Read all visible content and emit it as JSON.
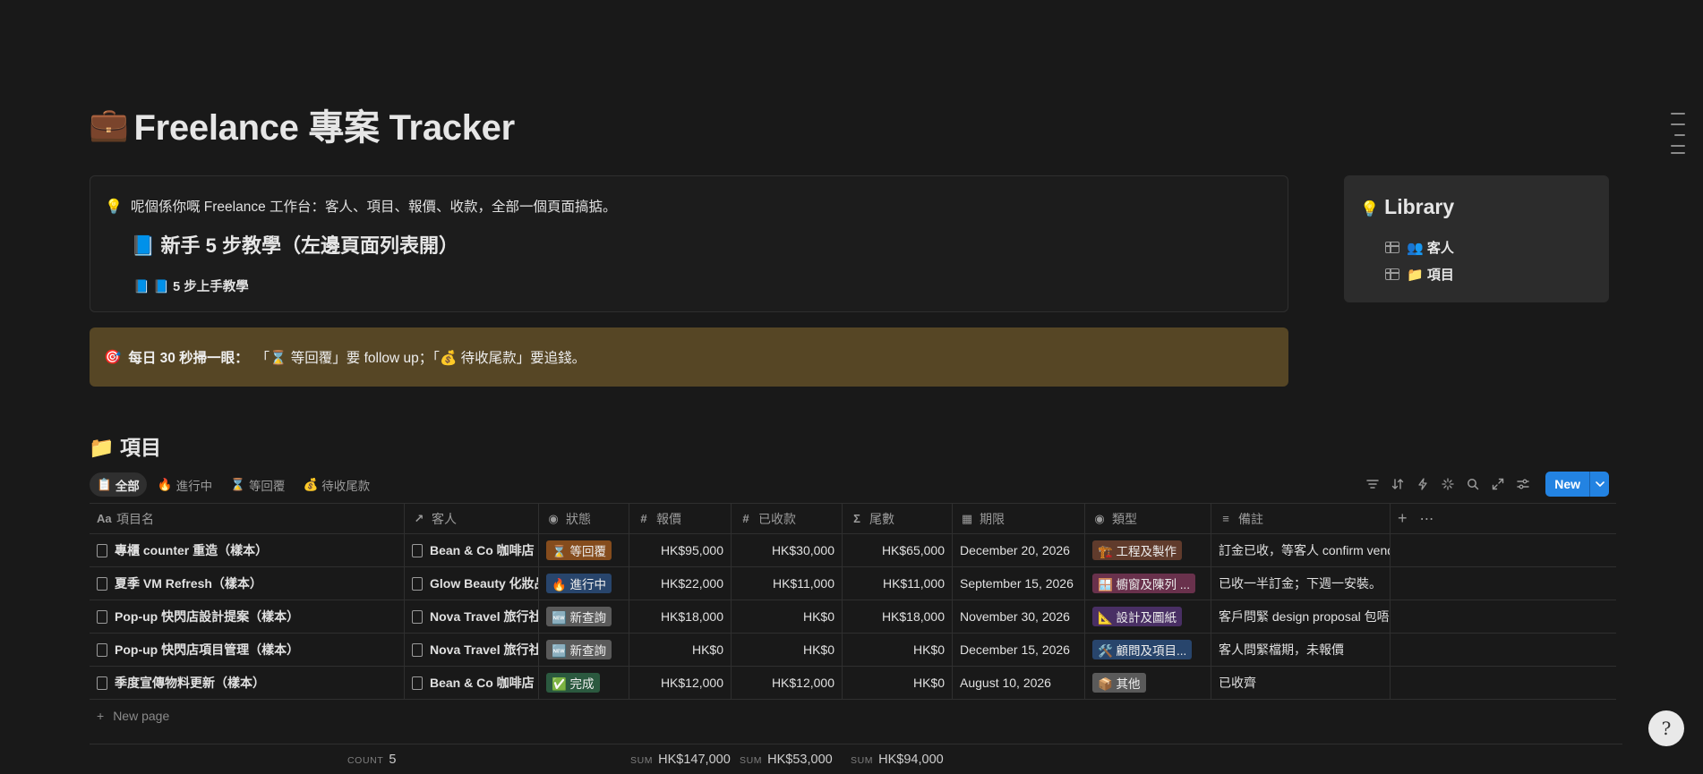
{
  "page": {
    "title_emoji": "💼",
    "title": "Freelance 專案 Tracker"
  },
  "info_callout": {
    "icon": "💡",
    "intro": "呢個係你嘅 Freelance 工作台：客人、項目、報價、收款，全部一個頁面搞掂。",
    "heading": "📘 新手 5 步教學（左邊頁面列表開）",
    "link": "📘 📘 5 步上手教學"
  },
  "library": {
    "icon": "💡",
    "title": "Library",
    "items": [
      "👥 客人",
      "📁 項目"
    ]
  },
  "tip_callout": {
    "icon": "🎯",
    "bold": "每日 30 秒掃一眼：",
    "text": "「⌛ 等回覆」要 follow up；「💰 待收尾款」要追錢。"
  },
  "section": {
    "title": "📁 項目"
  },
  "views": [
    {
      "icon": "📋",
      "label": "全部",
      "active": true
    },
    {
      "icon": "🔥",
      "label": "進行中",
      "active": false
    },
    {
      "icon": "⌛",
      "label": "等回覆",
      "active": false
    },
    {
      "icon": "💰",
      "label": "待收尾款",
      "active": false
    }
  ],
  "toolbar": {
    "icons": [
      "filter-icon",
      "sort-icon",
      "automation-icon",
      "ai-icon",
      "search-icon",
      "expand-icon",
      "settings-icon"
    ],
    "new_label": "New",
    "accent": "#2383e2"
  },
  "table": {
    "headers": {
      "name": "項目名",
      "client": "客人",
      "status": "狀態",
      "quote": "報價",
      "received": "已收款",
      "balance": "尾數",
      "deadline": "期限",
      "type": "類型",
      "note": "備註"
    },
    "rows": [
      {
        "name": "專櫃 counter 重造（樣本）",
        "client": "Bean & Co 咖啡店",
        "status": "⌛ 等回覆",
        "status_color": "#854c1d",
        "quote": "HK$95,000",
        "received": "HK$30,000",
        "balance": "HK$65,000",
        "deadline": "December 20, 2026",
        "type": "🏗️ 工程及製作",
        "type_color": "#603b2c",
        "note": "訂金已收，等客人 confirm vendor"
      },
      {
        "name": "夏季 VM Refresh（樣本）",
        "client": "Glow Beauty 化妝品",
        "status": "🔥 進行中",
        "status_color": "#28456c",
        "quote": "HK$22,000",
        "received": "HK$11,000",
        "balance": "HK$11,000",
        "deadline": "September 15, 2026",
        "type": "🪟 櫥窗及陳列 ...",
        "type_color": "#69314c",
        "note": "已收一半訂金；下週一安裝。"
      },
      {
        "name": "Pop-up 快閃店設計提案（樣本）",
        "client": "Nova Travel 旅行社",
        "status": "🆕 新查詢",
        "status_color": "#5a5a5a",
        "quote": "HK$18,000",
        "received": "HK$0",
        "balance": "HK$18,000",
        "deadline": "November 30, 2026",
        "type": "📐 設計及圖紙",
        "type_color": "#492f64",
        "note": "客戶問緊 design proposal 包唔包"
      },
      {
        "name": "Pop-up 快閃店項目管理（樣本）",
        "client": "Nova Travel 旅行社",
        "status": "🆕 新查詢",
        "status_color": "#5a5a5a",
        "quote": "HK$0",
        "received": "HK$0",
        "balance": "HK$0",
        "deadline": "December 15, 2026",
        "type": "🛠️ 顧問及項目...",
        "type_color": "#28456c",
        "note": "客人問緊檔期，未報價"
      },
      {
        "name": "季度宣傳物料更新（樣本）",
        "client": "Bean & Co 咖啡店",
        "status": "✅ 完成",
        "status_color": "#2b593f",
        "quote": "HK$12,000",
        "received": "HK$12,000",
        "balance": "HK$0",
        "deadline": "August 10, 2026",
        "type": "📦 其他",
        "type_color": "#5a5a5a",
        "note": "已收齊"
      }
    ],
    "new_page": "New page"
  },
  "footer": {
    "count_label": "COUNT",
    "count": "5",
    "sum_label": "SUM",
    "sum_quote": "HK$147,000",
    "sum_received": "HK$53,000",
    "sum_balance": "HK$94,000"
  },
  "help": {
    "icon": "?"
  }
}
